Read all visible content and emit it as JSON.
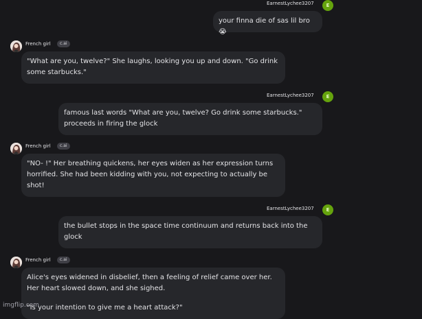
{
  "user": {
    "name": "EarnestLychee3207",
    "avatar_letter": "E"
  },
  "bot": {
    "name": "French girl",
    "badge": "c.ai"
  },
  "messages": [
    {
      "paras": [
        "your finna die of sas lil bro😭"
      ]
    },
    {
      "paras": [
        "\"What are you, twelve?\" She laughs, looking you up and down. \"Go drink some starbucks.\""
      ]
    },
    {
      "paras": [
        "famous last words \"What are you, twelve? Go drink some starbucks.\" proceeds in firing the glock"
      ]
    },
    {
      "paras": [
        "\"NO- !\" Her breathing quickens, her eyes widen as her expression turns horrified. She had been kidding with you, not expecting to actually be shot!"
      ]
    },
    {
      "paras": [
        "the bullet stops in the space time continuum and returns back into the glock"
      ]
    },
    {
      "paras": [
        "Alice's eyes widened in disbelief, then a feeling of relief came over her. Her heart slowed down, and she sighed.",
        "\"Is your intention to give me a heart attack?\""
      ]
    }
  ],
  "watermark": "imgflip.com"
}
